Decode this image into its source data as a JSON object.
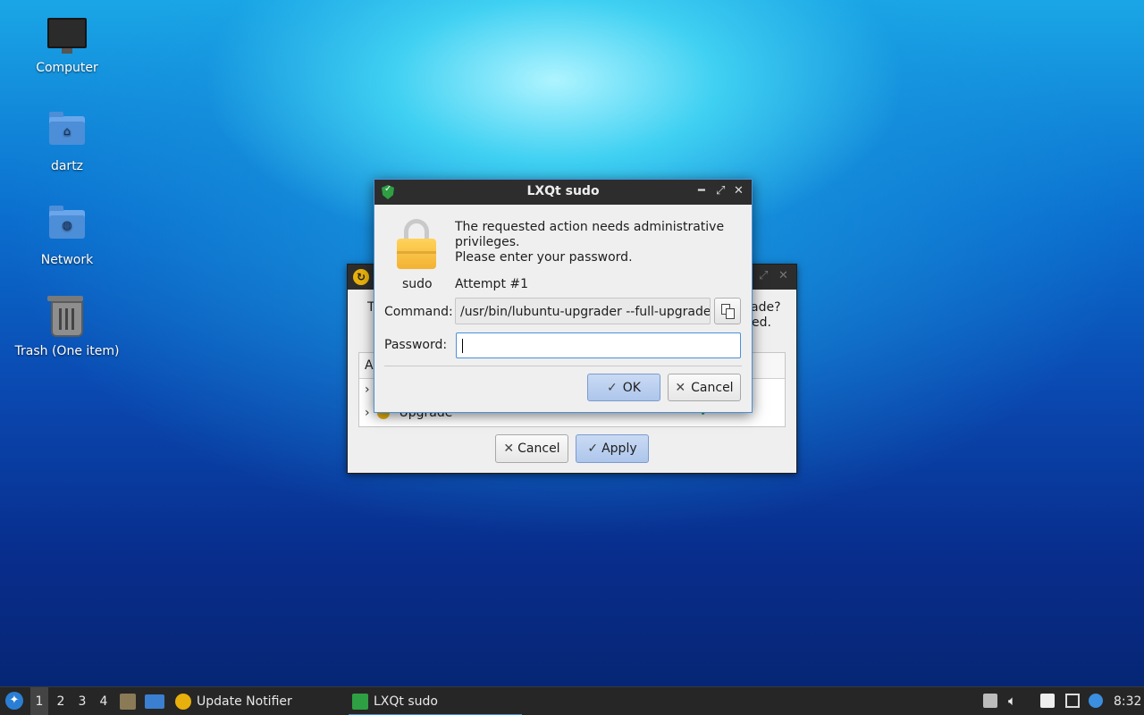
{
  "desktop": {
    "icons": [
      {
        "label": "Computer",
        "icon": "computer-icon"
      },
      {
        "label": "dartz",
        "icon": "home-folder-icon"
      },
      {
        "label": "Network",
        "icon": "network-folder-icon"
      },
      {
        "label": "Trash (One item)",
        "icon": "trash-icon"
      }
    ]
  },
  "bg_window": {
    "message_fragment_left": "T",
    "message_fragment_right_1": "ade?",
    "message_fragment_right_2": "ed.",
    "tree_header": "A",
    "tree_row_upgrade": "Upgrade",
    "cancel_label": "Cancel",
    "apply_label": "Apply"
  },
  "sudo_dialog": {
    "title": "LXQt sudo",
    "message_line1": "The requested action needs administrative",
    "message_line2": "privileges.",
    "message_line3": "Please enter your password.",
    "icon_caption": "sudo",
    "attempt": "Attempt #1",
    "command_label": "Command:",
    "command_value": "/usr/bin/lubuntu-upgrader --full-upgrade",
    "password_label": "Password:",
    "password_value": "",
    "ok_label": "OK",
    "cancel_label": "Cancel"
  },
  "taskbar": {
    "workspaces": [
      "1",
      "2",
      "3",
      "4"
    ],
    "tasks": [
      {
        "label": "Update Notifier"
      },
      {
        "label": "LXQt sudo"
      }
    ],
    "clock": "8:32"
  }
}
